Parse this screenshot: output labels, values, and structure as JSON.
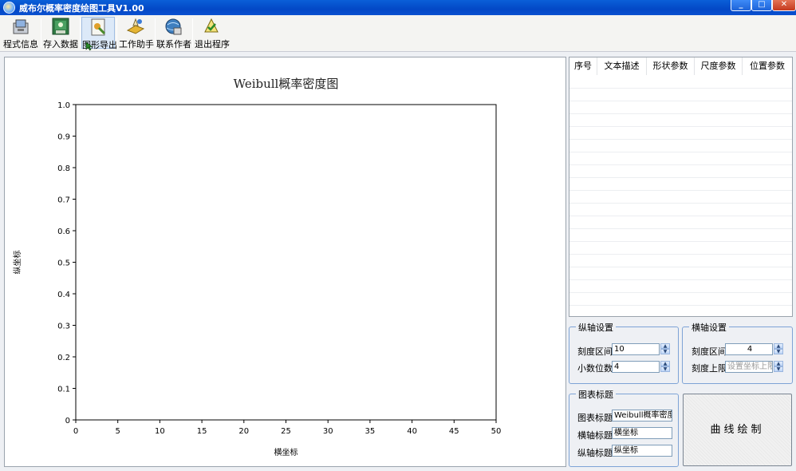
{
  "window": {
    "title": "威布尔概率密度绘图工具V1.00",
    "controls": {
      "minimize": "_",
      "maximize": "□",
      "close": "✕"
    }
  },
  "toolbar": {
    "items": [
      {
        "label": "程式信息",
        "icon": "program-info-icon"
      },
      {
        "label": "存入数据",
        "icon": "save-data-icon"
      },
      {
        "label": "图形导出",
        "icon": "export-graph-icon"
      },
      {
        "label": "工作助手",
        "icon": "work-assistant-icon"
      },
      {
        "label": "联系作者",
        "icon": "contact-author-icon"
      },
      {
        "label": "退出程序",
        "icon": "exit-program-icon"
      }
    ]
  },
  "table": {
    "columns": [
      "序号",
      "文本描述",
      "形状参数",
      "尺度参数",
      "位置参数"
    ]
  },
  "y_axis_settings": {
    "title": "纵轴设置",
    "interval_label": "刻度区间",
    "interval_value": "10",
    "decimals_label": "小数位数",
    "decimals_value": "4"
  },
  "x_axis_settings": {
    "title": "横轴设置",
    "interval_label": "刻度区间",
    "interval_value": "4",
    "upper_label": "刻度上限",
    "upper_placeholder": "设置坐标上限"
  },
  "chart_titles": {
    "title": "图表标题",
    "chart_title_label": "图表标题",
    "chart_title_value": "Weibull概率密度图",
    "x_title_label": "横轴标题",
    "x_title_value": "横坐标",
    "y_title_label": "纵轴标题",
    "y_title_value": "纵坐标"
  },
  "draw_button": "曲线绘制",
  "chart_data": {
    "type": "line",
    "title": "Weibull概率密度图",
    "xlabel": "横坐标",
    "ylabel": "纵坐标",
    "xlim": [
      0,
      50
    ],
    "ylim": [
      0,
      1.0
    ],
    "xticks": [
      "0",
      "5",
      "10",
      "15",
      "20",
      "25",
      "30",
      "35",
      "40",
      "45",
      "50"
    ],
    "yticks": [
      "0",
      "0.1",
      "0.2",
      "0.3",
      "0.4",
      "0.5",
      "0.6",
      "0.7",
      "0.8",
      "0.9",
      "1.0"
    ],
    "series": [],
    "grid": false
  }
}
